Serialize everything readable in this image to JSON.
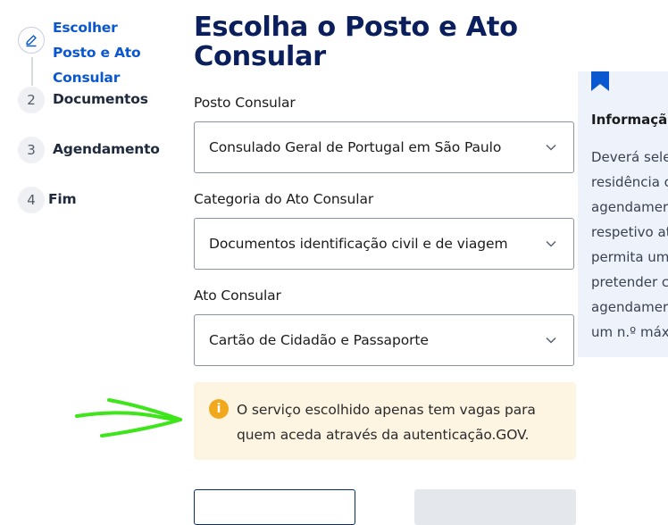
{
  "stepper": {
    "steps": [
      {
        "number": "",
        "label": "Escolher Posto e Ato Consular",
        "active": true
      },
      {
        "number": "2",
        "label": "Documentos"
      },
      {
        "number": "3",
        "label": "Agendamento"
      },
      {
        "number": "4",
        "label": "Fim"
      }
    ]
  },
  "page": {
    "title": "Escolha o Posto e Ato Consular"
  },
  "form": {
    "posto": {
      "label": "Posto Consular",
      "value": "Consulado Geral de Portugal em São Paulo"
    },
    "categoria": {
      "label": "Categoria do Ato Consular",
      "value": "Documentos identificação civil e de viagem"
    },
    "ato": {
      "label": "Ato Consular",
      "value": "Cartão de Cidadão e Passaporte"
    }
  },
  "alert": {
    "icon": "info-icon",
    "text_line1": "O serviço escolhido apenas tem vagas para",
    "text_line2": "quem aceda através da autenticação.GOV.",
    "color": "#fdf4e2"
  },
  "info_panel": {
    "title": "Informação",
    "lines": [
      "Deverá sele",
      "residência c",
      "agendamer",
      "respetivo at",
      "permita um",
      "pretender c",
      "agendamer",
      "um n.º máx"
    ]
  },
  "colors": {
    "accent": "#0b57d0",
    "title": "#0a1f5c",
    "annotation_arrow": "#3ee51a"
  }
}
